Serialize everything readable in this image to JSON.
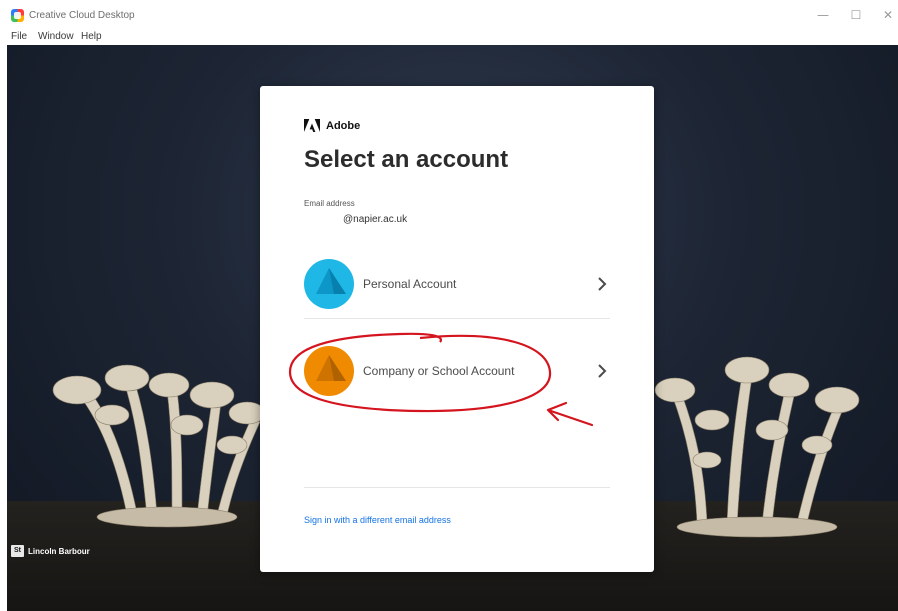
{
  "window": {
    "title": "Creative Cloud Desktop",
    "controls": {
      "minimize": "—",
      "maximize": "☐",
      "close": "✕"
    }
  },
  "menu": {
    "file": "File",
    "window": "Window",
    "help": "Help"
  },
  "dialog": {
    "brand": "Adobe",
    "heading": "Select an account",
    "email_label": "Email address",
    "email_value": "@napier.ac.uk",
    "accounts": [
      {
        "label": "Personal Account",
        "color": "#1fb8e6",
        "icon": "personal-account-icon"
      },
      {
        "label": "Company or School Account",
        "color": "#f08a00",
        "icon": "company-account-icon"
      }
    ],
    "alt_signin": "Sign in with a different email address"
  },
  "background": {
    "credit_badge": "St",
    "credit_name": "Lincoln Barbour"
  },
  "colors": {
    "link": "#1473e6",
    "annotation": "#d4141e",
    "adobe_brand": "#111111"
  }
}
